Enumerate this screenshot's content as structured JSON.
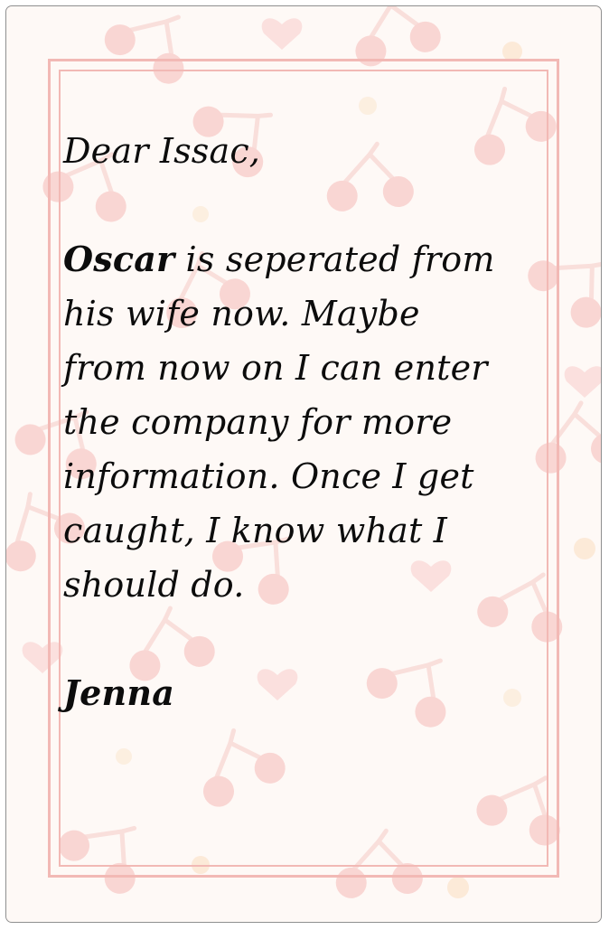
{
  "letter": {
    "greeting": "Dear Issac,",
    "body_name": "Oscar",
    "body_lines": [
      " is seperated from",
      "his wife now. Maybe",
      "from now on I can enter",
      "the company for more",
      "information. Once I get",
      "caught, I know what I",
      "should do."
    ],
    "signature": "Jenna"
  },
  "colors": {
    "paper": "#fdf7f4",
    "frame": "#f2b9b5",
    "cherry": "#f4b1ad",
    "stem": "#f3c2bf",
    "dot": "#f9d9b7",
    "text": "#0c0c0c"
  },
  "decor": [
    "cherry-icon",
    "heart-icon",
    "dot-icon"
  ]
}
